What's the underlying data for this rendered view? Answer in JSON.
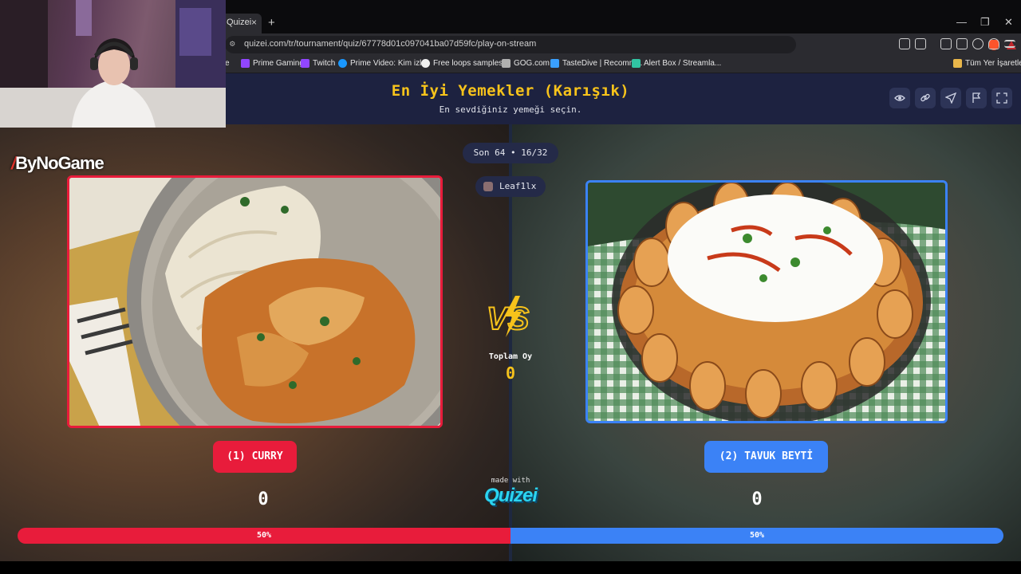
{
  "browser": {
    "tab_title": "Quizei",
    "url": "quizei.com/tr/tournament/quiz/67778d01c097041ba07d59fc/play-on-stream",
    "bookmarks": [
      {
        "label": "e",
        "color": "#7b4de0"
      },
      {
        "label": "Prime Gaming",
        "color": "#9146ff"
      },
      {
        "label": "Twitch",
        "color": "#9146ff"
      },
      {
        "label": "Prime Video: Kim izl...",
        "color": "#1a98ff"
      },
      {
        "label": "Free loops samples...",
        "color": "#f0f0f0"
      },
      {
        "label": "GOG.com",
        "color": "#b0b0b0"
      },
      {
        "label": "TasteDive | Recomm...",
        "color": "#3aa0ff"
      },
      {
        "label": "Alert Box / Streamla...",
        "color": "#31c3a2"
      }
    ],
    "all_bookmarks": "Tüm Yer İşaretleri"
  },
  "quiz": {
    "title": "En İyi Yemekler (Karışık)",
    "subtitle": "En sevdiğiniz yemeği seçin.",
    "round": "Son 64 • 16/32",
    "user": "Leaf1lx",
    "brand": "ByNoGame",
    "total_label": "Toplam Oy",
    "total_value": "0",
    "made_with": "made with",
    "logo": "Quizei"
  },
  "options": [
    {
      "label": "(1) CURRY",
      "votes": "0",
      "percent": "50%",
      "color": "#e81c3b"
    },
    {
      "label": "(2) TAVUK BEYTİ",
      "votes": "0",
      "percent": "50%",
      "color": "#3b82f6"
    }
  ],
  "header_icons": [
    "eye-icon",
    "link-icon",
    "send-icon",
    "flag-icon",
    "fullscreen-icon"
  ]
}
